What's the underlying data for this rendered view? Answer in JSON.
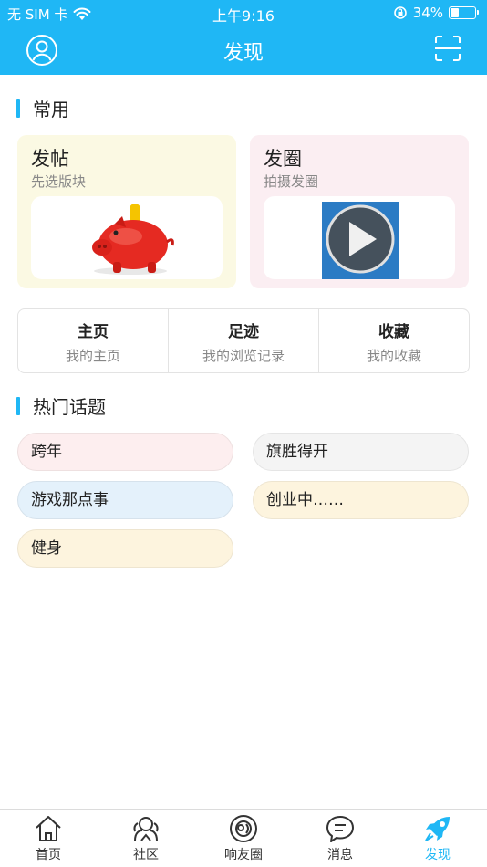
{
  "status_bar": {
    "carrier": "无 SIM 卡",
    "time": "上午9:16",
    "battery": "34%",
    "battery_level": 0.34
  },
  "nav": {
    "title": "发现",
    "left_icon": "user-circle-icon",
    "right_icon": "scan-icon"
  },
  "common": {
    "title": "常用",
    "cards": [
      {
        "title": "发帖",
        "subtitle": "先选版块",
        "image": "piggy-bank-image"
      },
      {
        "title": "发圈",
        "subtitle": "拍摄发圈",
        "image": "play-video-image"
      }
    ],
    "quick_links": [
      {
        "title": "主页",
        "subtitle": "我的主页"
      },
      {
        "title": "足迹",
        "subtitle": "我的浏览记录"
      },
      {
        "title": "收藏",
        "subtitle": "我的收藏"
      }
    ]
  },
  "hot_topics": {
    "title": "热门话题",
    "items": [
      {
        "label": "跨年",
        "color": "#fdeeef"
      },
      {
        "label": "旗胜得开",
        "color": "#f4f4f4"
      },
      {
        "label": "游戏那点事",
        "color": "#e4f1fb"
      },
      {
        "label": "创业中……",
        "color": "#fdf4de"
      },
      {
        "label": "健身",
        "color": "#fdf4de"
      }
    ]
  },
  "tabbar": {
    "active_color": "#1fb7f5",
    "items": [
      {
        "label": "首页",
        "icon": "home-icon"
      },
      {
        "label": "社区",
        "icon": "community-icon"
      },
      {
        "label": "响友圈",
        "icon": "friends-circle-icon"
      },
      {
        "label": "消息",
        "icon": "message-icon"
      },
      {
        "label": "发现",
        "icon": "rocket-icon",
        "active": true
      }
    ]
  }
}
